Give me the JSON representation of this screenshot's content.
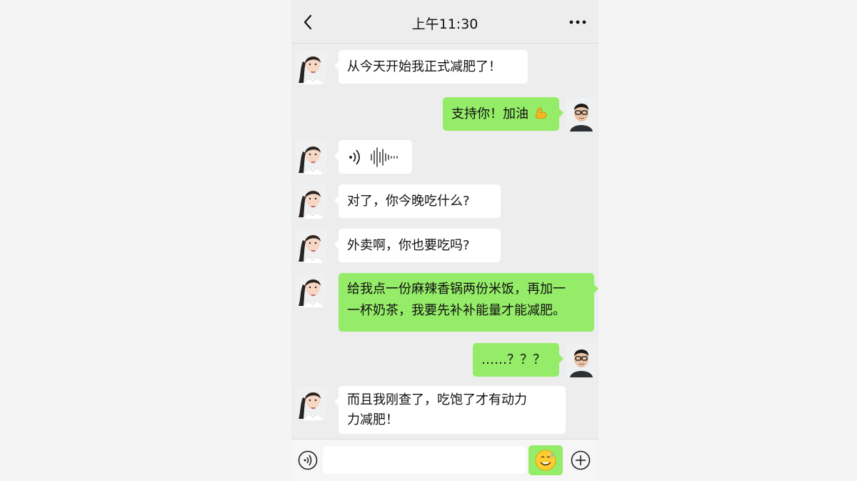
{
  "header": {
    "back_icon": "chevron-left-icon",
    "time": "上午11:30",
    "more_icon": "more-dots-icon"
  },
  "messages": [
    {
      "sender": "girl",
      "type": "text",
      "text": "从今天开始我正式减肥了！"
    },
    {
      "sender": "me",
      "type": "text",
      "text": "支持你！加油",
      "emoji": "flexed-biceps-icon"
    },
    {
      "sender": "girl",
      "type": "voice",
      "icon": "voice-wave-icon"
    },
    {
      "sender": "girl",
      "type": "text",
      "text": "对了，你今晚吃什么?"
    },
    {
      "sender": "girl",
      "type": "text",
      "text": "外卖啊，你也要吃吗?"
    },
    {
      "sender": "girl",
      "type": "text",
      "highlighted": true,
      "lines": [
        "给我点一份麻辣香锅两份米饭，再加一",
        "一杯奶茶，我要先补补能量才能减肥。"
      ]
    },
    {
      "sender": "me",
      "type": "text",
      "text": "……？？？"
    },
    {
      "sender": "girl",
      "type": "text",
      "lines": [
        "而且我刚查了，吃饱了才有动力",
        "力减肥！"
      ]
    }
  ],
  "footer": {
    "voice_icon": "voice-toggle-icon",
    "input_value": "",
    "emoji_icon": "sweat-smile-emoji-icon",
    "plus_icon": "plus-circle-icon"
  },
  "colors": {
    "accent_green": "#95ec69",
    "chat_background": "#ededed",
    "bubble_white": "#ffffff"
  }
}
